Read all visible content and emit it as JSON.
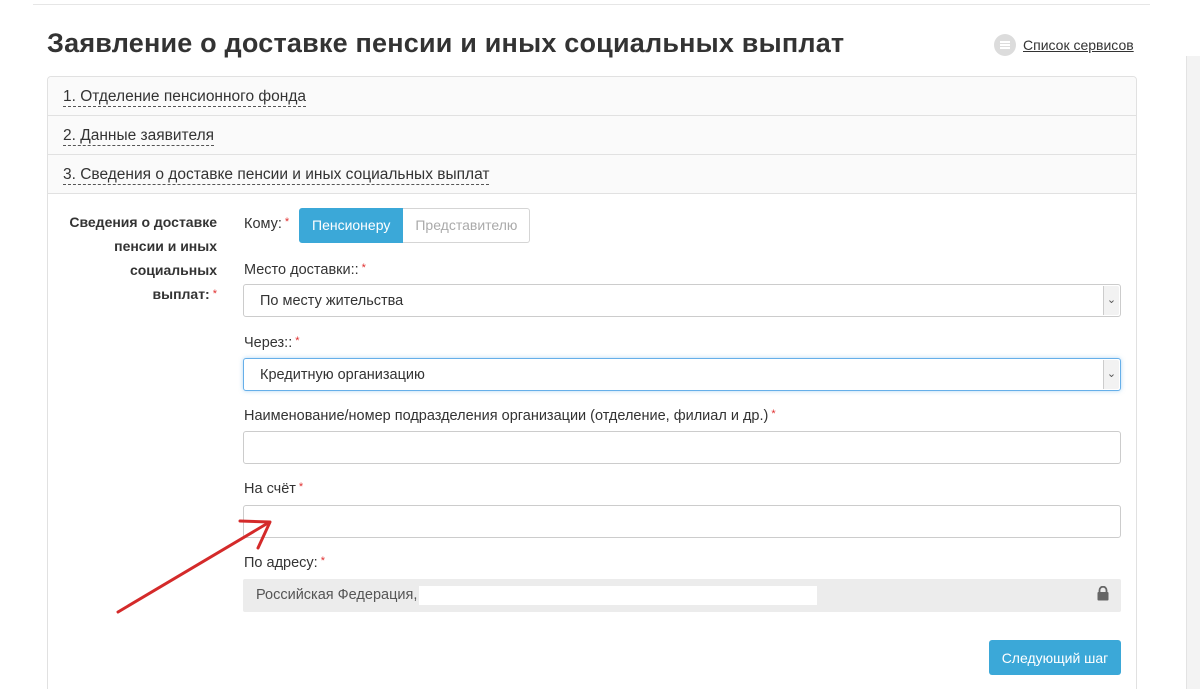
{
  "page": {
    "title": "Заявление о доставке пенсии и иных социальных выплат",
    "services_link": "Список сервисов",
    "services_icon": "list-icon"
  },
  "steps": [
    {
      "label": "1. Отделение пенсионного фонда"
    },
    {
      "label": "2. Данные заявителя"
    },
    {
      "label": "3. Сведения о доставке пенсии и иных социальных выплат"
    }
  ],
  "section": {
    "label": "Сведения о доставке пенсии и иных социальных выплат:",
    "required_mark": "*"
  },
  "form": {
    "recipient": {
      "label": "Кому:",
      "options": [
        "Пенсионеру",
        "Представителю"
      ],
      "selected": "Пенсионеру"
    },
    "delivery_place": {
      "label": "Место доставки::",
      "value": "По месту жительства"
    },
    "via": {
      "label": "Через::",
      "value": "Кредитную организацию"
    },
    "branch": {
      "label": "Наименование/номер подразделения организации (отделение, филиал и др.)",
      "value": ""
    },
    "account": {
      "label": "На счёт",
      "value": ""
    },
    "address": {
      "label": "По адресу:",
      "value": "Российская Федерация,"
    },
    "next_button": "Следующий шаг"
  },
  "colors": {
    "accent": "#3ba8d8",
    "required": "#e03030",
    "annotation_arrow": "#d42a2a"
  }
}
